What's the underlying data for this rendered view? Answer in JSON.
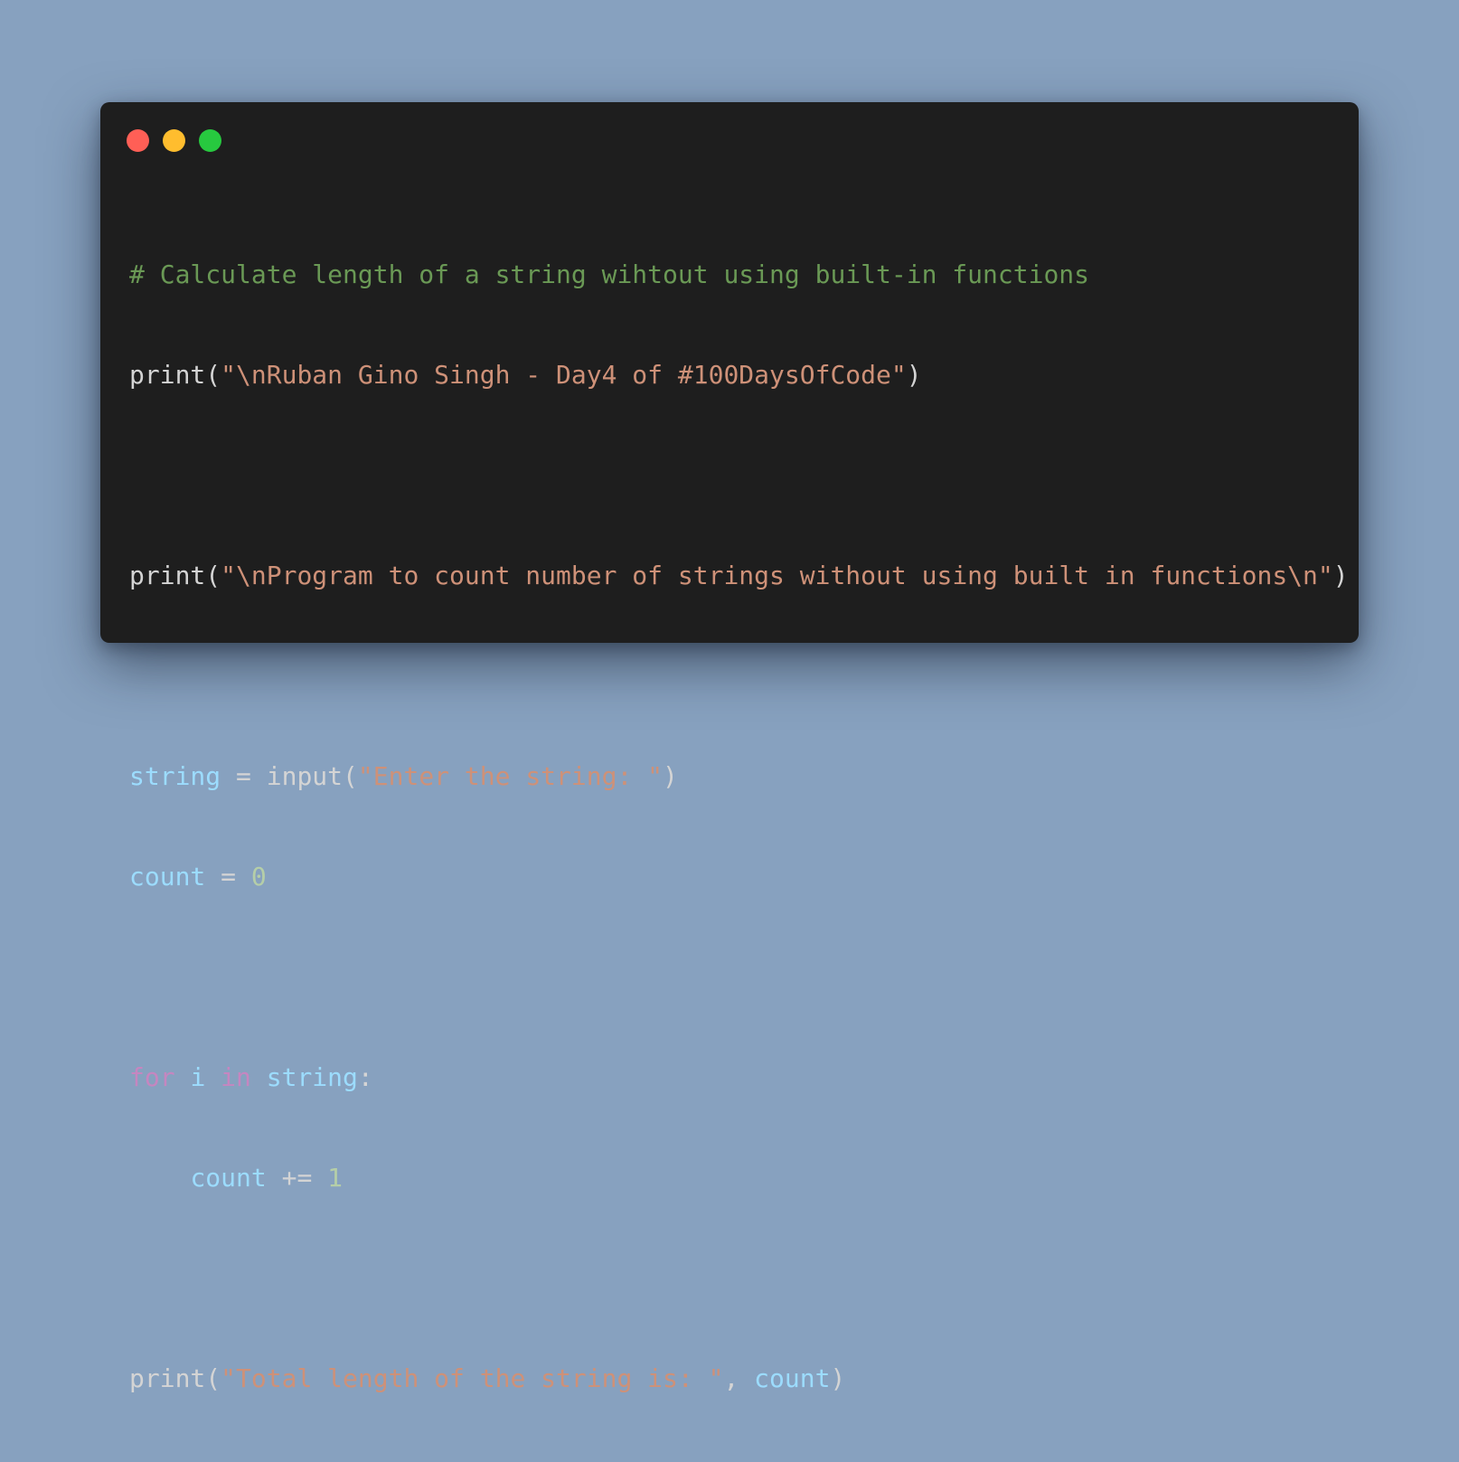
{
  "window": {
    "controls": [
      {
        "name": "close",
        "color": "#ff5f56"
      },
      {
        "name": "minimize",
        "color": "#ffbd2e"
      },
      {
        "name": "maximize",
        "color": "#27c93f"
      }
    ]
  },
  "colors": {
    "background": "#87a1bf",
    "editor_background": "#1e1e1e",
    "comment": "#6a9955",
    "string": "#ce9178",
    "variable": "#9cdcfe",
    "keyword": "#c586c0",
    "number": "#b5cea8",
    "default": "#d4d4d4"
  },
  "code": {
    "line1_comment": "# Calculate length of a string wihtout using built-in functions",
    "line2_func": "print",
    "line2_open": "(",
    "line2_string": "\"\\nRuban Gino Singh - Day4 of #100DaysOfCode\"",
    "line2_close": ")",
    "line4_func": "print",
    "line4_open": "(",
    "line4_string": "\"\\nProgram to count number of strings without using built in functions\\n\"",
    "line4_close": ")",
    "line6_var": "string",
    "line6_op": " = ",
    "line6_func": "input",
    "line6_open": "(",
    "line6_string": "\"Enter the string: \"",
    "line6_close": ")",
    "line7_var": "count",
    "line7_op": " = ",
    "line7_num": "0",
    "line9_kw_for": "for",
    "line9_space1": " ",
    "line9_var_i": "i",
    "line9_space2": " ",
    "line9_kw_in": "in",
    "line9_space3": " ",
    "line9_var_string": "string",
    "line9_colon": ":",
    "line10_indent": "    ",
    "line10_var": "count",
    "line10_op": " += ",
    "line10_num": "1",
    "line12_func": "print",
    "line12_open": "(",
    "line12_string": "\"Total length of the string is: \"",
    "line12_comma": ", ",
    "line12_var": "count",
    "line12_close": ")"
  }
}
